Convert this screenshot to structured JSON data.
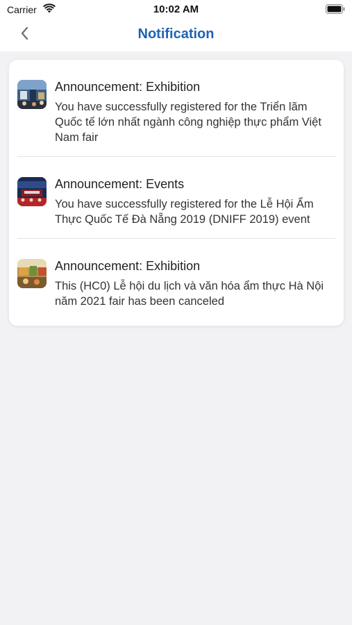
{
  "status_bar": {
    "carrier": "Carrier",
    "time": "10:02 AM"
  },
  "nav": {
    "title": "Notification"
  },
  "notifications": [
    {
      "title": "Announcement: Exhibition",
      "body": "You have successfully registered for the Triển lãm Quốc tế lớn nhất ngành công nghiệp thực phẩm Việt Nam fair"
    },
    {
      "title": "Announcement: Events",
      "body": "You have successfully registered for the Lễ Hội Ẩm Thực Quốc Tế Đà Nẵng 2019 (DNIFF 2019) event"
    },
    {
      "title": "Announcement: Exhibition",
      "body": "This (HC0) Lễ hội du lịch và văn hóa ẩm thực Hà Nội năm 2021 fair has been canceled"
    }
  ],
  "colors": {
    "title_blue": "#1e63b5",
    "background": "#f2f2f4",
    "card": "#ffffff"
  }
}
